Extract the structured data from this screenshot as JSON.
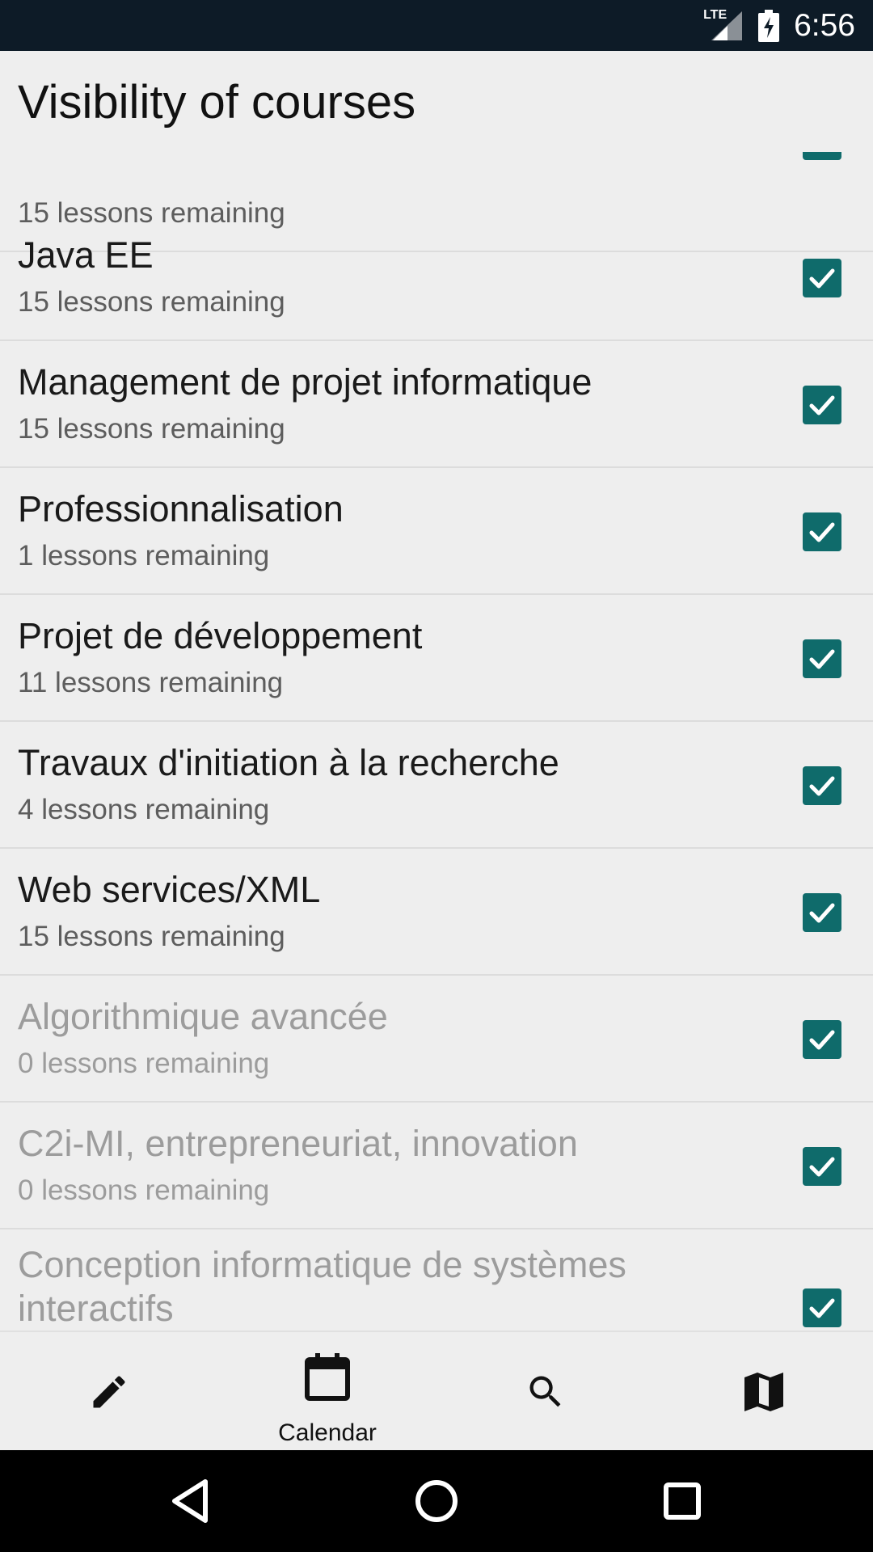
{
  "status_bar": {
    "network_label": "LTE",
    "time": "6:56"
  },
  "header": {
    "title": "Visibility of courses"
  },
  "courses": [
    {
      "title": "",
      "subtitle": "15 lessons remaining",
      "checked": true,
      "active": true
    },
    {
      "title": "Java EE",
      "subtitle": "15 lessons remaining",
      "checked": true,
      "active": true
    },
    {
      "title": "Management de projet informatique",
      "subtitle": "15 lessons remaining",
      "checked": true,
      "active": true
    },
    {
      "title": "Professionnalisation",
      "subtitle": "1 lessons remaining",
      "checked": true,
      "active": true
    },
    {
      "title": "Projet de développement",
      "subtitle": "11 lessons remaining",
      "checked": true,
      "active": true
    },
    {
      "title": "Travaux d'initiation à la recherche",
      "subtitle": "4 lessons remaining",
      "checked": true,
      "active": true
    },
    {
      "title": "Web services/XML",
      "subtitle": "15 lessons remaining",
      "checked": true,
      "active": true
    },
    {
      "title": "Algorithmique avancée",
      "subtitle": "0 lessons remaining",
      "checked": true,
      "active": false
    },
    {
      "title": "C2i-MI, entrepreneuriat, innovation",
      "subtitle": "0 lessons remaining",
      "checked": true,
      "active": false
    },
    {
      "title": "Conception informatique de systèmes interactifs",
      "subtitle": "",
      "checked": true,
      "active": false
    }
  ],
  "bottom_nav": {
    "items": [
      {
        "icon": "pencil-icon",
        "label": ""
      },
      {
        "icon": "calendar-icon",
        "label": "Calendar"
      },
      {
        "icon": "search-icon",
        "label": ""
      },
      {
        "icon": "map-icon",
        "label": ""
      }
    ]
  },
  "system_nav": {
    "icons": [
      "back-icon",
      "home-icon",
      "recents-icon"
    ]
  },
  "colors": {
    "status_bar": "#0d1b27",
    "background": "#eeeeee",
    "checkbox": "#0f6b6b",
    "divider": "#dcdcdc",
    "inactive_text": "#9c9c9c"
  }
}
